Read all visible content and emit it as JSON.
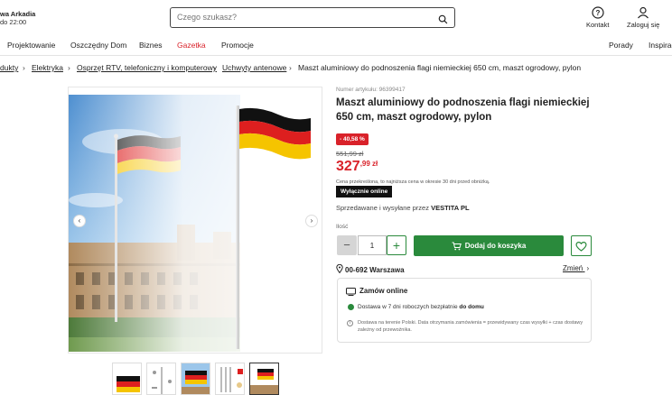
{
  "store": {
    "name": "wa Arkadia",
    "hours": "do 22:00"
  },
  "search": {
    "placeholder": "Czego szukasz?"
  },
  "header": {
    "contact_label": "Kontakt",
    "login_label": "Zaloguj się"
  },
  "nav": {
    "items": [
      "Projektowanie",
      "Oszczędny Dom",
      "Biznes",
      "Gazetka",
      "Promocje"
    ],
    "right_items": [
      "Porady",
      "Inspirac"
    ],
    "highlight_color": "#d9222a"
  },
  "breadcrumbs": [
    "dukty",
    "Elektryka",
    "Osprzęt RTV, telefoniczny i komputerowy",
    "Uchwyty antenowe",
    "Maszt aluminiowy do podnoszenia flagi niemieckiej 650 cm, maszt ogrodowy, pylon"
  ],
  "product": {
    "article": "Numer artykułu: 96399417",
    "title": "Maszt aluminiowy do podnoszenia flagi niemieckiej 650 cm, maszt ogrodowy, pylon",
    "discount": "- 40,58 %",
    "old_price": "551,99 zł",
    "price_main": "327",
    "price_rest": ",99 zł",
    "price_note": "Cena przekreślona, to najniższa cena w okresie 30 dni przed obniżką.",
    "badge": "Wyłącznie online",
    "seller_prefix": "Sprzedawane i wysyłane przez",
    "seller_name": "VESTITA PL",
    "qty_label": "Ilość",
    "qty_value": "1",
    "add_to_cart": "Dodaj do koszyka",
    "location": "00-692 Warszawa",
    "change_label": "Zmień",
    "order_title": "Zamów online",
    "delivery_prefix": "Dostawa w 7 dni roboczych",
    "delivery_mid": "bezpłatnie",
    "delivery_suffix": "do domu",
    "delivery_note": "Dostawa na terenie Polski. Data otrzymania zamówienia = przewidywany czas wysyłki + czas dostawy zależny od przewoźnika."
  },
  "colors": {
    "accent_green": "#2a8a3c",
    "price_red": "#d9222a"
  },
  "icons": [
    "search-icon",
    "help-icon",
    "user-icon",
    "cart-icon",
    "heart-icon",
    "location-pin-icon",
    "chevron-right-icon",
    "truck-icon",
    "info-icon"
  ]
}
